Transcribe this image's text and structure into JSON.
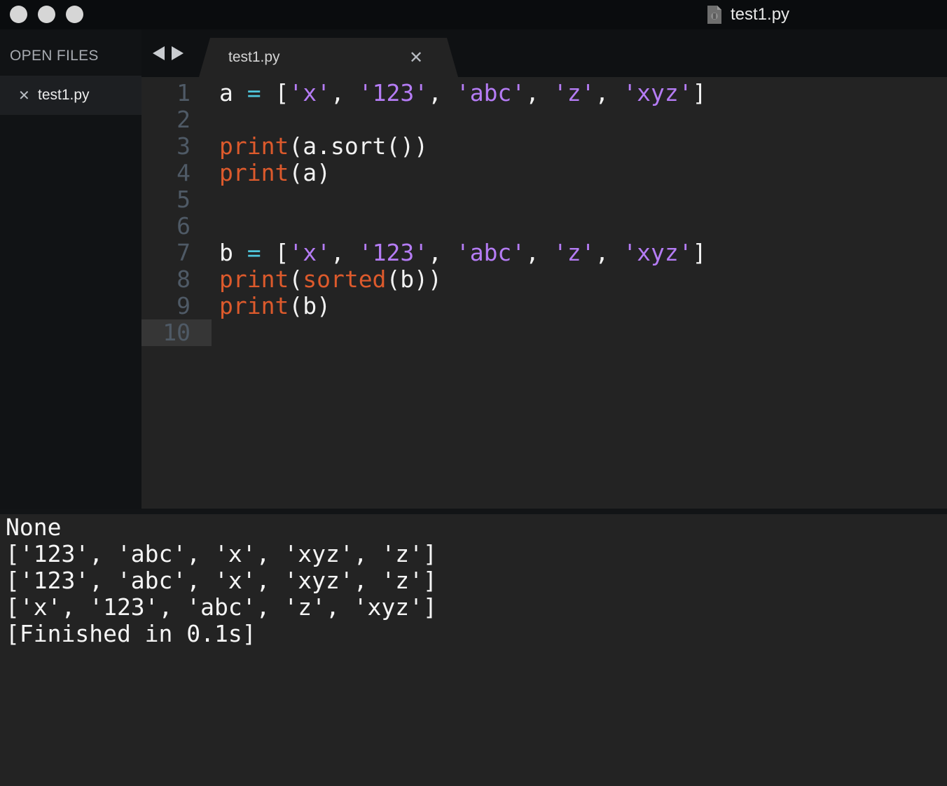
{
  "window": {
    "title": "test1.py",
    "file_icon": "python-file-icon",
    "traffic_lights": [
      "close",
      "minimize",
      "zoom"
    ]
  },
  "sidebar": {
    "header": "OPEN FILES",
    "items": [
      {
        "close_glyph": "✕",
        "label": "test1.py"
      }
    ]
  },
  "tabs": [
    {
      "label": "test1.py",
      "close_glyph": "✕",
      "active": true
    }
  ],
  "editor": {
    "active_line": "10",
    "lines": [
      {
        "num": "1",
        "tokens": [
          [
            "t",
            "a "
          ],
          [
            "op",
            "="
          ],
          [
            "t",
            " ["
          ],
          [
            "str",
            "'x'"
          ],
          [
            "t",
            ", "
          ],
          [
            "str",
            "'123'"
          ],
          [
            "t",
            ", "
          ],
          [
            "str",
            "'abc'"
          ],
          [
            "t",
            ", "
          ],
          [
            "str",
            "'z'"
          ],
          [
            "t",
            ", "
          ],
          [
            "str",
            "'xyz'"
          ],
          [
            "t",
            "]"
          ]
        ]
      },
      {
        "num": "2",
        "tokens": []
      },
      {
        "num": "3",
        "tokens": [
          [
            "kw",
            "print"
          ],
          [
            "t",
            "(a.sort())"
          ]
        ]
      },
      {
        "num": "4",
        "tokens": [
          [
            "kw",
            "print"
          ],
          [
            "t",
            "(a)"
          ]
        ]
      },
      {
        "num": "5",
        "tokens": []
      },
      {
        "num": "6",
        "tokens": []
      },
      {
        "num": "7",
        "tokens": [
          [
            "t",
            "b "
          ],
          [
            "op",
            "="
          ],
          [
            "t",
            " ["
          ],
          [
            "str",
            "'x'"
          ],
          [
            "t",
            ", "
          ],
          [
            "str",
            "'123'"
          ],
          [
            "t",
            ", "
          ],
          [
            "str",
            "'abc'"
          ],
          [
            "t",
            ", "
          ],
          [
            "str",
            "'z'"
          ],
          [
            "t",
            ", "
          ],
          [
            "str",
            "'xyz'"
          ],
          [
            "t",
            "]"
          ]
        ]
      },
      {
        "num": "8",
        "tokens": [
          [
            "kw",
            "print"
          ],
          [
            "t",
            "("
          ],
          [
            "kw",
            "sorted"
          ],
          [
            "t",
            "(b))"
          ]
        ]
      },
      {
        "num": "9",
        "tokens": [
          [
            "kw",
            "print"
          ],
          [
            "t",
            "(b)"
          ]
        ]
      },
      {
        "num": "10",
        "tokens": []
      }
    ]
  },
  "output": {
    "lines": [
      "None",
      "['123', 'abc', 'x', 'xyz', 'z']",
      "['123', 'abc', 'x', 'xyz', 'z']",
      "['x', '123', 'abc', 'z', 'xyz']",
      "[Finished in 0.1s]"
    ]
  },
  "colors": {
    "keyword": "#dd5a2c",
    "string": "#b57cf5",
    "operator": "#4fc6dc",
    "text": "#f2f2f2",
    "line_number": "#4f5a66",
    "background": "#232323"
  }
}
